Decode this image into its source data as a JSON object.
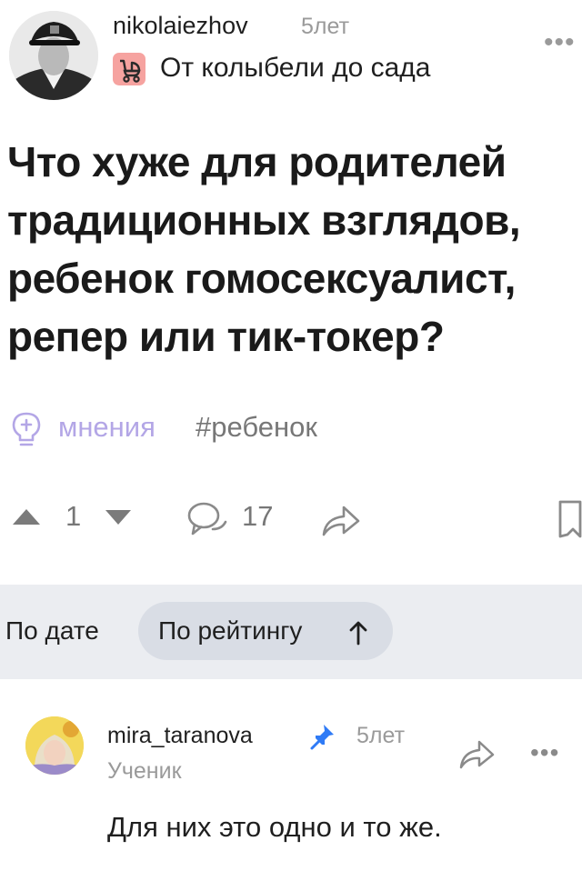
{
  "post": {
    "author": "nikolaiezhov",
    "time_ago": "5лет",
    "category": "От колыбели до сада",
    "title": "Что хуже для родителей традиционных взглядов, ребенок гомосексуалист, репер или тик-токер?",
    "tags": [
      {
        "label": "мнения",
        "color": "#b3a6e6"
      },
      {
        "label": "#ребенок",
        "color": "#777777"
      }
    ],
    "votes": "1",
    "comments_count": "17"
  },
  "sort": {
    "by_date": "По дате",
    "by_rating": "По рейтингу",
    "active": "По рейтингу"
  },
  "comment": {
    "author": "mira_taranova",
    "time_ago": "5лет",
    "rank": "Ученик",
    "text": "Для них это одно и то же."
  },
  "icons": {
    "category": "stroller-icon",
    "opinions": "lightbulb-icon",
    "upvote": "triangle-up-icon",
    "downvote": "triangle-down-icon",
    "comments": "speech-bubble-icon",
    "share": "share-arrow-icon",
    "bookmark": "bookmark-icon",
    "pinned": "pin-icon",
    "more": "more-dots-icon"
  },
  "colors": {
    "accent_violet": "#b3a6e6",
    "pin_blue": "#2f7bf6",
    "category_badge": "#f6a3a0",
    "sort_bar": "#ebedf1",
    "sort_active_pill": "#d9dde5"
  }
}
